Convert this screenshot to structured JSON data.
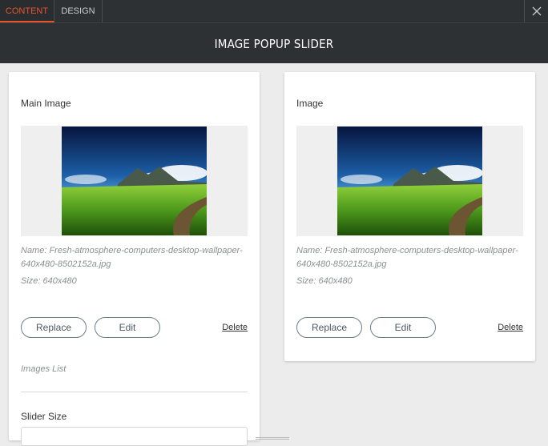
{
  "tabs": {
    "content": "CONTENT",
    "design": "DESIGN"
  },
  "header": {
    "title": "IMAGE POPUP SLIDER"
  },
  "main_image": {
    "label": "Main Image",
    "name": "Name: Fresh-atmosphere-computers-desktop-wallpaper-640x480-8502152a.jpg",
    "size": "Size: 640x480",
    "replace_label": "Replace",
    "edit_label": "Edit",
    "delete_label": "Delete"
  },
  "images_list": {
    "label": "Images List"
  },
  "slider_size": {
    "label": "Slider Size"
  },
  "image_item": {
    "label": "Image",
    "name": "Name: Fresh-atmosphere-computers-desktop-wallpaper-640x480-8502152a.jpg",
    "size": "Size: 640x480",
    "replace_label": "Replace",
    "edit_label": "Edit",
    "delete_label": "Delete"
  },
  "colors": {
    "accent": "#e8542e",
    "header_bg": "#2e3133",
    "page_bg": "#ececec",
    "button_border": "#6e7f87"
  },
  "icons": {
    "close": "close-icon"
  }
}
